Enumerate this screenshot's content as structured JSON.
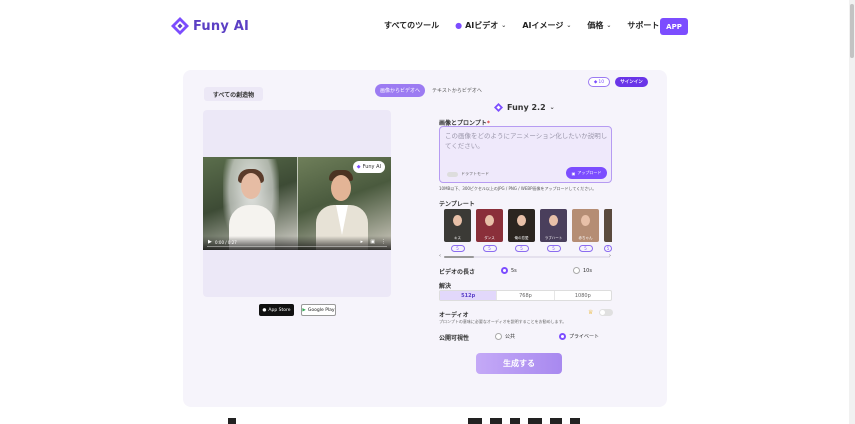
{
  "header": {
    "brand": "Funy AI",
    "nav": [
      {
        "label": "すべてのツール",
        "icon": "",
        "dropdown": false
      },
      {
        "label": "AIビデオ",
        "icon": "fire-icon",
        "dropdown": true
      },
      {
        "label": "AIイメージ",
        "icon": "",
        "dropdown": true
      },
      {
        "label": "価格",
        "icon": "",
        "dropdown": true
      },
      {
        "label": "サポート",
        "icon": "",
        "dropdown": true
      }
    ],
    "app_label": "APP"
  },
  "left": {
    "tab_label": "すべての創造物",
    "video": {
      "badge": "Funy AI",
      "time": "0:00 / 0:27"
    },
    "stores": {
      "appstore": "App Store",
      "googleplay": "Google Play"
    }
  },
  "mode_switch": {
    "active": "画像からビデオへ",
    "inactive": "テキストからビデオへ"
  },
  "account": {
    "credits": "10",
    "signin": "サインイン"
  },
  "form": {
    "model": "Funy 2.2",
    "prompt_label": "画像とプロンプト",
    "prompt_required": "*",
    "prompt_placeholder": "この画像をどのようにアニメーション化したいか説明してください。",
    "draft_mode": "ドラフトモード",
    "upload": "アップロード",
    "hint": "10MB以下、300ピクセル以上のJPG / PNG / WEBP画像をアップロードしてください。",
    "templates_label": "テンプレート",
    "templates": [
      {
        "name": "キス",
        "count": "5",
        "color": "#3b3a36"
      },
      {
        "name": "ダンス",
        "count": "5",
        "color": "#8a2f3a"
      },
      {
        "name": "俺の恋愛",
        "count": "5",
        "color": "#2b2520"
      },
      {
        "name": "ラブハート",
        "count": "5",
        "color": "#4a3f5c"
      },
      {
        "name": "赤ちゃん",
        "count": "5",
        "color": "#b58d74"
      },
      {
        "name": "",
        "count": "5",
        "color": "#5a4a3d"
      }
    ],
    "duration_label": "ビデオの長さ",
    "durations": [
      {
        "label": "5s",
        "selected": true
      },
      {
        "label": "10s",
        "selected": false
      }
    ],
    "resolution_label": "解決",
    "resolutions": [
      {
        "label": "512p",
        "selected": true
      },
      {
        "label": "768p",
        "selected": false
      },
      {
        "label": "1080p",
        "selected": false
      }
    ],
    "audio_label": "オーディオ",
    "audio_desc": "プロンプトの意味に必要なオーディオを説明することをお勧めします。",
    "visibility_label": "公開可視性",
    "visibility": [
      {
        "label": "公共",
        "selected": false
      },
      {
        "label": "プライベート",
        "selected": true
      }
    ],
    "generate": "生成する"
  },
  "colors": {
    "accent": "#7c4dff",
    "accent_soft": "#9c7bf2",
    "card_bg": "#f6f4fb"
  }
}
